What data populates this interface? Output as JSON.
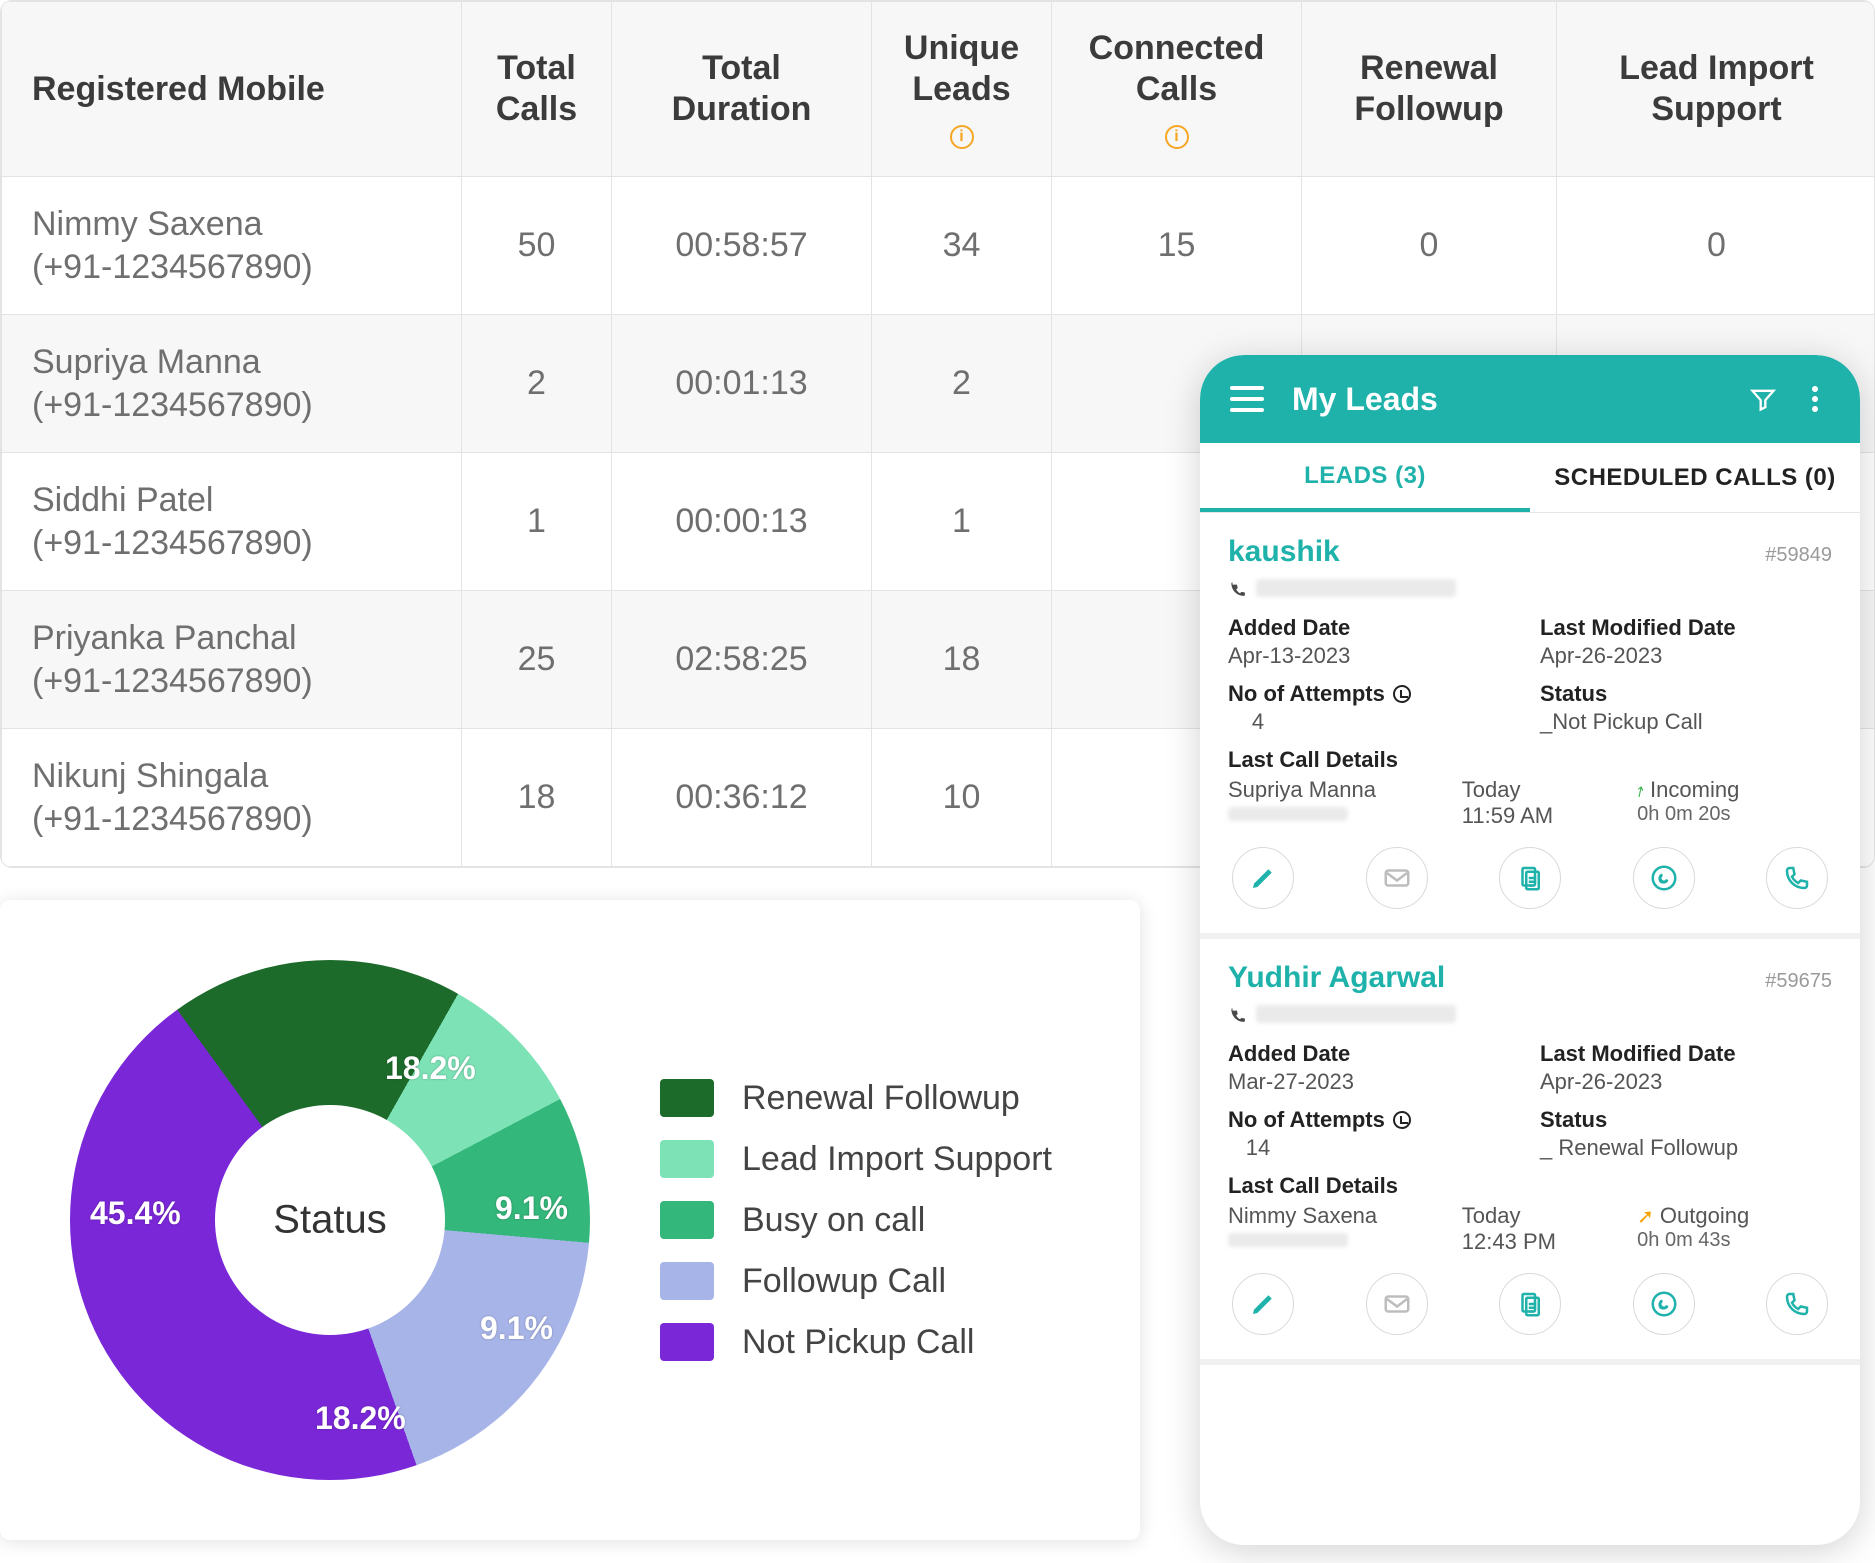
{
  "table": {
    "headers": {
      "registered_mobile": "Registered Mobile",
      "total_calls": "Total Calls",
      "total_duration": "Total Duration",
      "unique_leads": "Unique Leads",
      "connected_calls": "Connected Calls",
      "renewal_followup": "Renewal Followup",
      "lead_import_support": "Lead Import Support"
    },
    "rows": [
      {
        "name": "Nimmy Saxena",
        "phone": "(+91-1234567890)",
        "total_calls": "50",
        "total_duration": "00:58:57",
        "unique_leads": "34",
        "connected_calls": "15",
        "renewal_followup": "0",
        "lead_import_support": "0"
      },
      {
        "name": "Supriya Manna",
        "phone": "(+91-1234567890)",
        "total_calls": "2",
        "total_duration": "00:01:13",
        "unique_leads": "2",
        "connected_calls": "",
        "renewal_followup": "",
        "lead_import_support": ""
      },
      {
        "name": "Siddhi Patel",
        "phone": "(+91-1234567890)",
        "total_calls": "1",
        "total_duration": "00:00:13",
        "unique_leads": "1",
        "connected_calls": "",
        "renewal_followup": "",
        "lead_import_support": ""
      },
      {
        "name": "Priyanka Panchal",
        "phone": "(+91-1234567890)",
        "total_calls": "25",
        "total_duration": "02:58:25",
        "unique_leads": "18",
        "connected_calls": "",
        "renewal_followup": "",
        "lead_import_support": ""
      },
      {
        "name": "Nikunj Shingala",
        "phone": "(+91-1234567890)",
        "total_calls": "18",
        "total_duration": "00:36:12",
        "unique_leads": "10",
        "connected_calls": "",
        "renewal_followup": "",
        "lead_import_support": ""
      }
    ]
  },
  "chart_data": {
    "type": "pie",
    "title": "Status",
    "series": [
      {
        "name": "Renewal Followup",
        "value": 18.2,
        "color": "#1d6b2b"
      },
      {
        "name": "Lead Import Support",
        "value": 9.1,
        "color": "#7de2b6"
      },
      {
        "name": "Busy on call",
        "value": 9.1,
        "color": "#34b77a"
      },
      {
        "name": "Followup Call",
        "value": 18.2,
        "color": "#a7b4e8"
      },
      {
        "name": "Not Pickup Call",
        "value": 45.4,
        "color": "#7a27d8"
      }
    ],
    "labels": {
      "0": "18.2%",
      "1": "9.1%",
      "2": "9.1%",
      "3": "18.2%",
      "4": "45.4%"
    }
  },
  "phone": {
    "title": "My Leads",
    "tabs": {
      "leads": "LEADS (3)",
      "scheduled": "SCHEDULED CALLS (0)"
    },
    "leads": [
      {
        "name": "kaushik",
        "id": "#59849",
        "added_label": "Added Date",
        "added": "Apr-13-2023",
        "modified_label": "Last Modified Date",
        "modified": "Apr-26-2023",
        "attempts_label": "No of Attempts",
        "attempts": "4",
        "status_label": "Status",
        "status": "_Not Pickup Call",
        "lcd_label": "Last Call Details",
        "lcd_name": "Supriya Manna",
        "lcd_day": "Today",
        "lcd_time": "11:59 AM",
        "lcd_dir": "Incoming",
        "direction": "in",
        "lcd_dur": "0h 0m 20s"
      },
      {
        "name": "Yudhir Agarwal",
        "id": "#59675",
        "added_label": "Added Date",
        "added": "Mar-27-2023",
        "modified_label": "Last Modified Date",
        "modified": "Apr-26-2023",
        "attempts_label": "No of Attempts",
        "attempts": "14",
        "status_label": "Status",
        "status": "_ Renewal Followup",
        "lcd_label": "Last Call Details",
        "lcd_name": "Nimmy Saxena",
        "lcd_day": "Today",
        "lcd_time": "12:43 PM",
        "lcd_dir": "Outgoing",
        "direction": "out",
        "lcd_dur": "0h 0m 43s"
      }
    ]
  }
}
